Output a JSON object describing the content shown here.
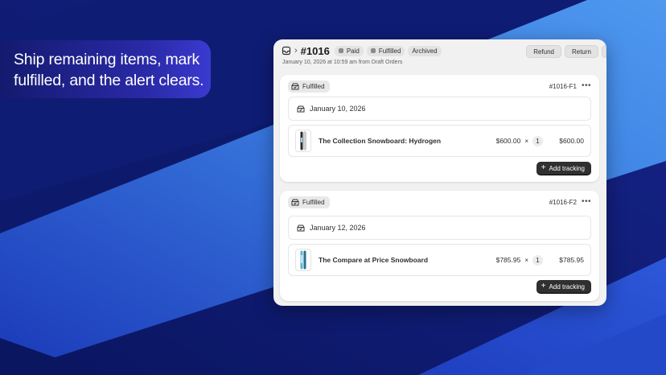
{
  "caption": {
    "text": "Ship remaining items, mark fulfilled, and the alert clears."
  },
  "order": {
    "title": "#1016",
    "badges": [
      {
        "label": "Paid",
        "dot": true
      },
      {
        "label": "Fulfilled",
        "dot": true
      },
      {
        "label": "Archived",
        "dot": false
      }
    ],
    "subtitle": "January 10, 2026 at 10:59 am from Draft Orders",
    "actions": {
      "refund": "Refund",
      "return": "Return"
    }
  },
  "fulfillments": [
    {
      "status": "Fulfilled",
      "id": "#1016-F1",
      "date": "January 10, 2026",
      "item": {
        "name": "The Collection Snowboard: Hydrogen",
        "price": "$600.00",
        "times": "×",
        "qty": "1",
        "total": "$600.00",
        "thumb_color": "#d9d9d9"
      },
      "tracking_label": "Add tracking"
    },
    {
      "status": "Fulfilled",
      "id": "#1016-F2",
      "date": "January 12, 2026",
      "item": {
        "name": "The Compare at Price Snowboard",
        "price": "$785.95",
        "times": "×",
        "qty": "1",
        "total": "$785.95",
        "thumb_color": "#5bb6d8"
      },
      "tracking_label": "Add tracking"
    }
  ],
  "colors": {
    "bg_dark": "#0b1660",
    "bg_blue": "#3d7fe0",
    "primary_button": "#303030"
  }
}
